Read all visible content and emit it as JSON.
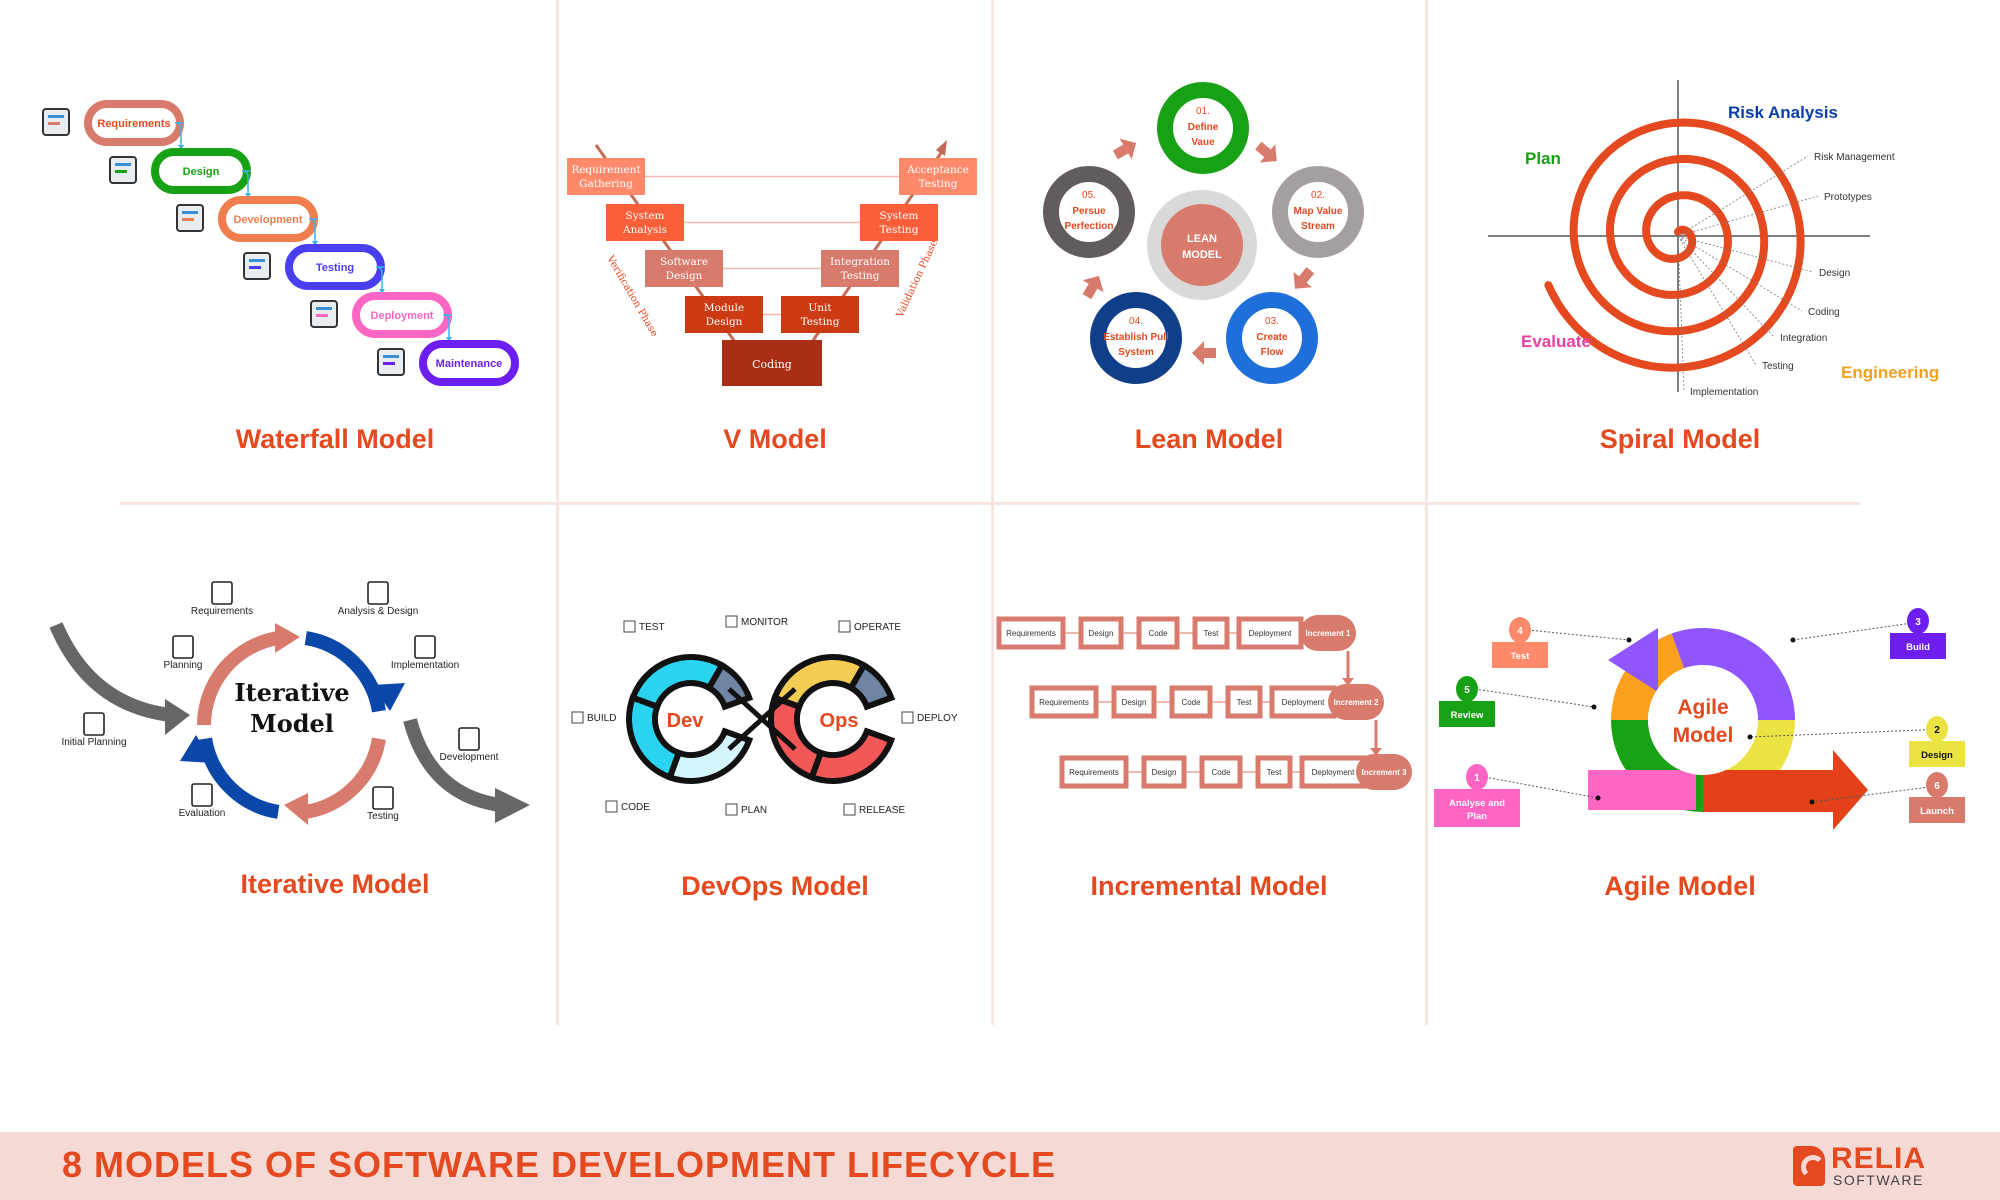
{
  "footer": {
    "title": "8 MODELS OF SOFTWARE DEVELOPMENT LIFECYCLE",
    "logo_main": "RELIA",
    "logo_sub": "SOFTWARE"
  },
  "colors": {
    "accent": "#e4491f",
    "footer_bg": "#f4d9d4",
    "divider": "#f6e6e2"
  },
  "panels": {
    "waterfall": {
      "title": "Waterfall Model",
      "steps": [
        {
          "label": "Requirements",
          "color": "#d97b6c",
          "text_color": "#e4491f",
          "icon": "clipboard-gear-icon"
        },
        {
          "label": "Design",
          "color": "#17a114",
          "text_color": "#17a114",
          "icon": "monitor-design-icon"
        },
        {
          "label": "Development",
          "color": "#f07d4d",
          "text_color": "#f07d4d",
          "icon": "code-window-icon"
        },
        {
          "label": "Testing",
          "color": "#4a3ff0",
          "text_color": "#4a3ff0",
          "icon": "laptop-test-icon"
        },
        {
          "label": "Deployment",
          "color": "#ff66c4",
          "text_color": "#ff66c4",
          "icon": "cloud-upload-icon"
        },
        {
          "label": "Maintenance",
          "color": "#6c1ff0",
          "text_color": "#6c1ff0",
          "icon": "wrench-gears-icon"
        }
      ]
    },
    "v": {
      "title": "V Model",
      "left": [
        "Requirement Gathering",
        "System Analysis",
        "Software Design",
        "Module Design"
      ],
      "right": [
        "Acceptance Testing",
        "System Testing",
        "Integration Testing",
        "Unit Testing"
      ],
      "bottom": "Coding",
      "left_phase": "Verification Phase",
      "right_phase": "Validation Phase",
      "level_colors": [
        "#ff8a6b",
        "#fa5f3a",
        "#d97b6c",
        "#cc3a14"
      ],
      "bottom_color": "#a82f16"
    },
    "lean": {
      "title": "Lean Model",
      "center": [
        "LEAN",
        "MODEL"
      ],
      "steps": [
        {
          "num": "01.",
          "lines": [
            "Define",
            "Vaue"
          ],
          "color": "#17a114"
        },
        {
          "num": "02.",
          "lines": [
            "Map Value",
            "Stream"
          ],
          "color": "#a59f9f"
        },
        {
          "num": "03.",
          "lines": [
            "Create",
            "Flow"
          ],
          "color": "#1e6fd9"
        },
        {
          "num": "04.",
          "lines": [
            "Establish Pull",
            "System"
          ],
          "color": "#103f8a"
        },
        {
          "num": "05.",
          "lines": [
            "Persue",
            "Perfection"
          ],
          "color": "#625c5c"
        }
      ]
    },
    "spiral": {
      "title": "Spiral Model",
      "quadrants": [
        {
          "label": "Risk Analysis",
          "color": "#0b3ea8"
        },
        {
          "label": "Plan",
          "color": "#17a114"
        },
        {
          "label": "Evaluate",
          "color": "#e83fa3"
        },
        {
          "label": "Engineering",
          "color": "#f5a020"
        }
      ],
      "callouts": [
        "Risk Management",
        "Prototypes",
        "Design",
        "Coding",
        "Integration",
        "Testing",
        "Implementation"
      ]
    },
    "iterative": {
      "title": "Iterative Model",
      "center": [
        "Iterative",
        "Model"
      ],
      "labels": [
        "Requirements",
        "Analysis & Design",
        "Planning",
        "Implementation",
        "Initial Planning",
        "Development",
        "Evaluation",
        "Testing"
      ]
    },
    "devops": {
      "title": "DevOps Model",
      "left_word": "Dev",
      "right_word": "Ops",
      "labels": {
        "test": "TEST",
        "monitor": "MONITOR",
        "operate": "OPERATE",
        "build": "BUILD",
        "deploy": "DEPLOY",
        "code": "CODE",
        "plan": "PLAN",
        "release": "RELEASE"
      }
    },
    "incremental": {
      "title": "Incremental Model",
      "stages": [
        "Requirements",
        "Design",
        "Code",
        "Test",
        "Deployment"
      ],
      "increments": [
        "Increment 1",
        "Increment 2",
        "Increment 3"
      ]
    },
    "agile": {
      "title": "Agile Model",
      "center": [
        "Agile",
        "Model"
      ],
      "steps": [
        {
          "num": "1",
          "label": "Analyse and Plan",
          "color": "#ff66c4"
        },
        {
          "num": "2",
          "label": "Design",
          "color": "#ebe244"
        },
        {
          "num": "3",
          "label": "Build",
          "color": "#6c1ff0"
        },
        {
          "num": "4",
          "label": "Test",
          "color": "#ff8a6b"
        },
        {
          "num": "5",
          "label": "Review",
          "color": "#17a114"
        },
        {
          "num": "6",
          "label": "Launch",
          "color": "#d97b6c"
        }
      ]
    }
  }
}
